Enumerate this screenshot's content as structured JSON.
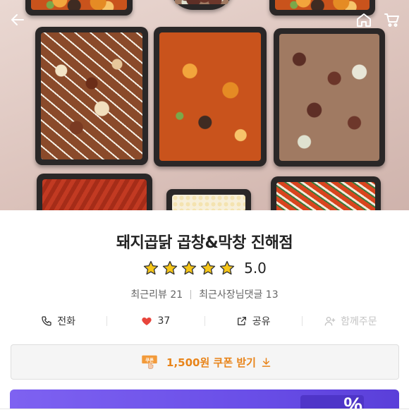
{
  "header": {
    "back_icon": "arrow-left-icon",
    "home_icon": "home-icon",
    "cart_icon": "cart-icon"
  },
  "store": {
    "name": "돼지곱닭 곱창&막창 진해점",
    "rating": "5.0",
    "stars": 5,
    "recent_reviews": "최근리뷰 21",
    "owner_replies": "최근사장님댓글 13"
  },
  "actions": [
    {
      "label": "전화",
      "icon": "phone-icon",
      "enabled": true
    },
    {
      "label": "37",
      "icon": "heart-icon",
      "enabled": true
    },
    {
      "label": "공유",
      "icon": "share-icon",
      "enabled": true
    },
    {
      "label": "함께주문",
      "icon": "add-person-icon",
      "enabled": false
    }
  ],
  "coupon": {
    "badge": "쿠폰",
    "label": "1,500원 쿠폰 받기",
    "icon": "download-icon"
  },
  "banner": {
    "text": "%"
  },
  "colors": {
    "accent": "#e8841a",
    "heart": "#e8453c",
    "star": "#f5c518",
    "banner": "#6a4fe8"
  }
}
